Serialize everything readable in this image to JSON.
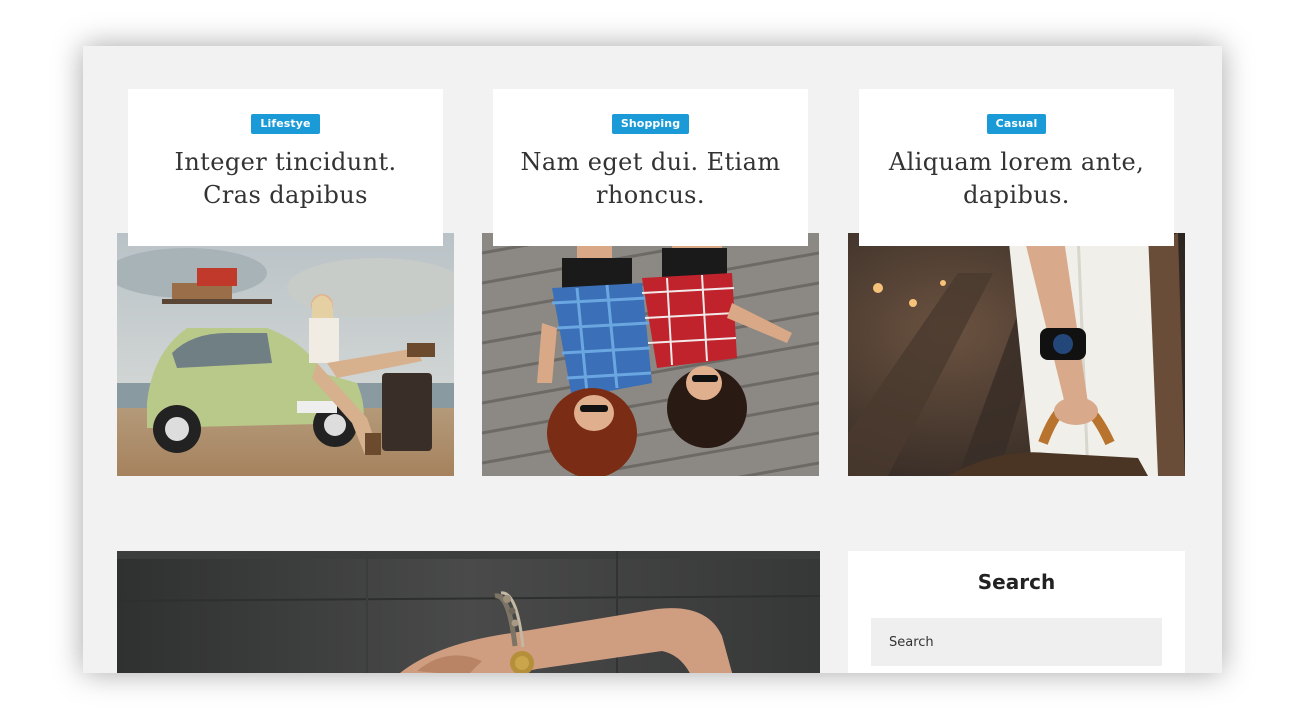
{
  "posts": [
    {
      "category": "Lifestye",
      "title": "Integer tincidunt. Cras dapibus"
    },
    {
      "category": "Shopping",
      "title": "Nam eget dui. Etiam rhoncus."
    },
    {
      "category": "Casual",
      "title": "Aliquam lorem ante, dapibus."
    }
  ],
  "sidebar": {
    "widget_title": "Search",
    "search_placeholder": "Search"
  },
  "colors": {
    "badge": "#1a9bd7",
    "page_background": "#f2f2f2",
    "card_background": "#ffffff"
  }
}
